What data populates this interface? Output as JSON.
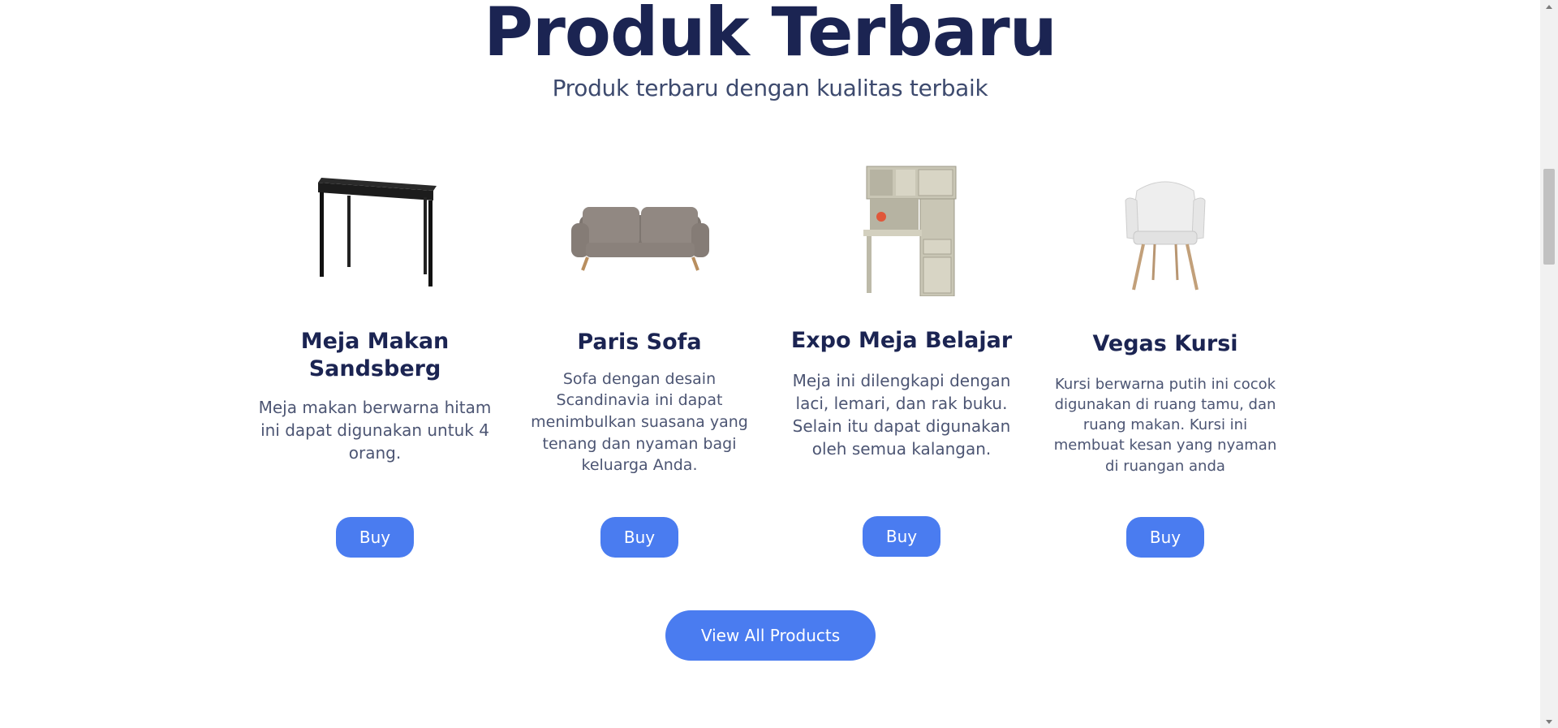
{
  "section": {
    "title": "Produk Terbaru",
    "subtitle": "Produk terbaru dengan kualitas terbaik"
  },
  "products": [
    {
      "name": "Meja Makan Sandsberg",
      "description": "Meja makan berwarna hitam ini dapat digunakan untuk 4 orang.",
      "buy_label": "Buy",
      "image_icon": "table-icon"
    },
    {
      "name": "Paris Sofa",
      "description": "Sofa dengan desain Scandinavia ini dapat menimbulkan suasana yang tenang dan nyaman bagi keluarga Anda.",
      "buy_label": "Buy",
      "image_icon": "sofa-icon"
    },
    {
      "name": "Expo Meja Belajar",
      "description": "Meja ini dilengkapi dengan laci, lemari, dan rak buku. Selain itu dapat digunakan oleh semua kalangan.",
      "buy_label": "Buy",
      "image_icon": "study-desk-icon"
    },
    {
      "name": "Vegas Kursi",
      "description": "Kursi berwarna putih ini cocok digunakan di ruang tamu, dan ruang makan. Kursi ini membuat kesan yang nyaman di ruangan anda",
      "buy_label": "Buy",
      "image_icon": "chair-icon"
    }
  ],
  "view_all_label": "View All Products",
  "colors": {
    "heading": "#1b2452",
    "accent": "#4a7cf0",
    "body_text": "#4c5573"
  }
}
